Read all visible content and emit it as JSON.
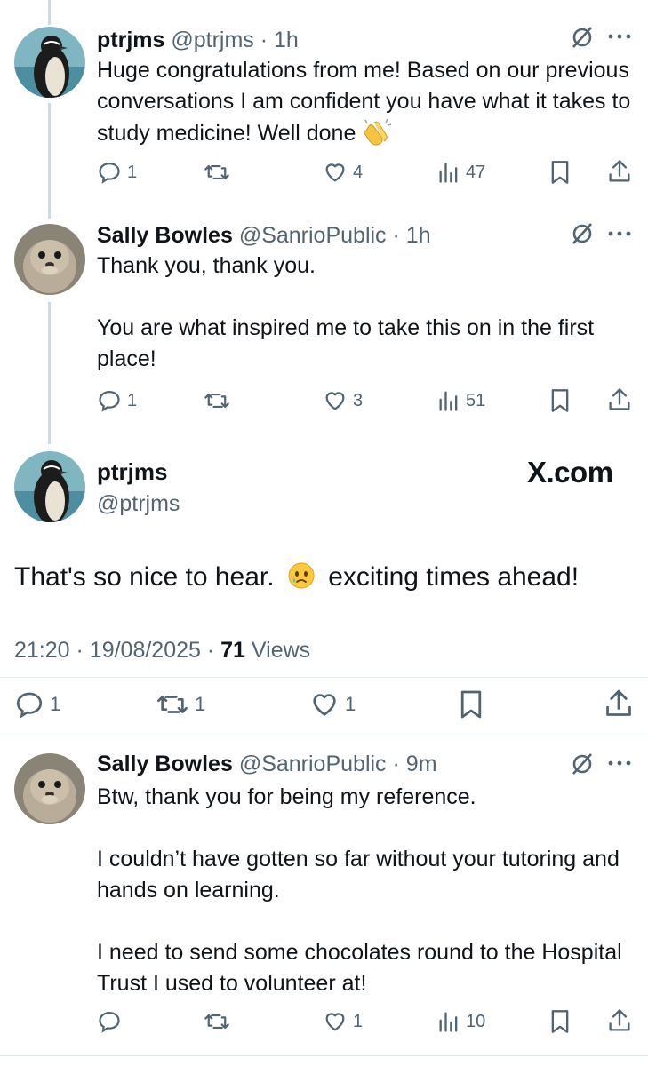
{
  "tweets": [
    {
      "name": "ptrjms",
      "handle": "@ptrjms",
      "dot": "·",
      "time": "1h",
      "lines": [
        "Huge congratulations from me! Based on our previous conversations I am confident you have what it takes to study medicine! Well done"
      ],
      "emoji": "clapping-hands",
      "replies": "1",
      "reposts": "",
      "likes": "4",
      "views": "47"
    },
    {
      "name": "Sally Bowles",
      "handle": "@SanrioPublic",
      "dot": "·",
      "time": "1h",
      "paragraphs": [
        "Thank you, thank you.",
        "You are what inspired me to take this on in the first place!"
      ],
      "replies": "1",
      "reposts": "",
      "likes": "3",
      "views": "51"
    },
    {
      "name": "Sally Bowles",
      "handle": "@SanrioPublic",
      "dot": "·",
      "time": "9m",
      "paragraphs": [
        "Btw, thank you for being my reference.",
        "I couldn’t have gotten so far without your tutoring and hands on learning.",
        "I need to send some chocolates round to the Hospital Trust I used to volunteer at!"
      ],
      "replies": "",
      "reposts": "",
      "likes": "1",
      "views": "10"
    }
  ],
  "main_tweet": {
    "name": "ptrjms",
    "handle": "@ptrjms",
    "brand": "X.com",
    "text_before": "That's so nice to hear.",
    "emoji": "face-holding-back-tears",
    "text_after": "exciting times ahead!",
    "time": "21:20",
    "sep": "·",
    "date": "19/08/2025",
    "views_count": "71",
    "views_label": "Views",
    "replies": "1",
    "reposts": "1",
    "likes": "1"
  },
  "colors": {
    "text": "#0f1419",
    "secondary": "#536471",
    "thread_line": "#cfd9de",
    "divider": "#e1e8ed"
  }
}
